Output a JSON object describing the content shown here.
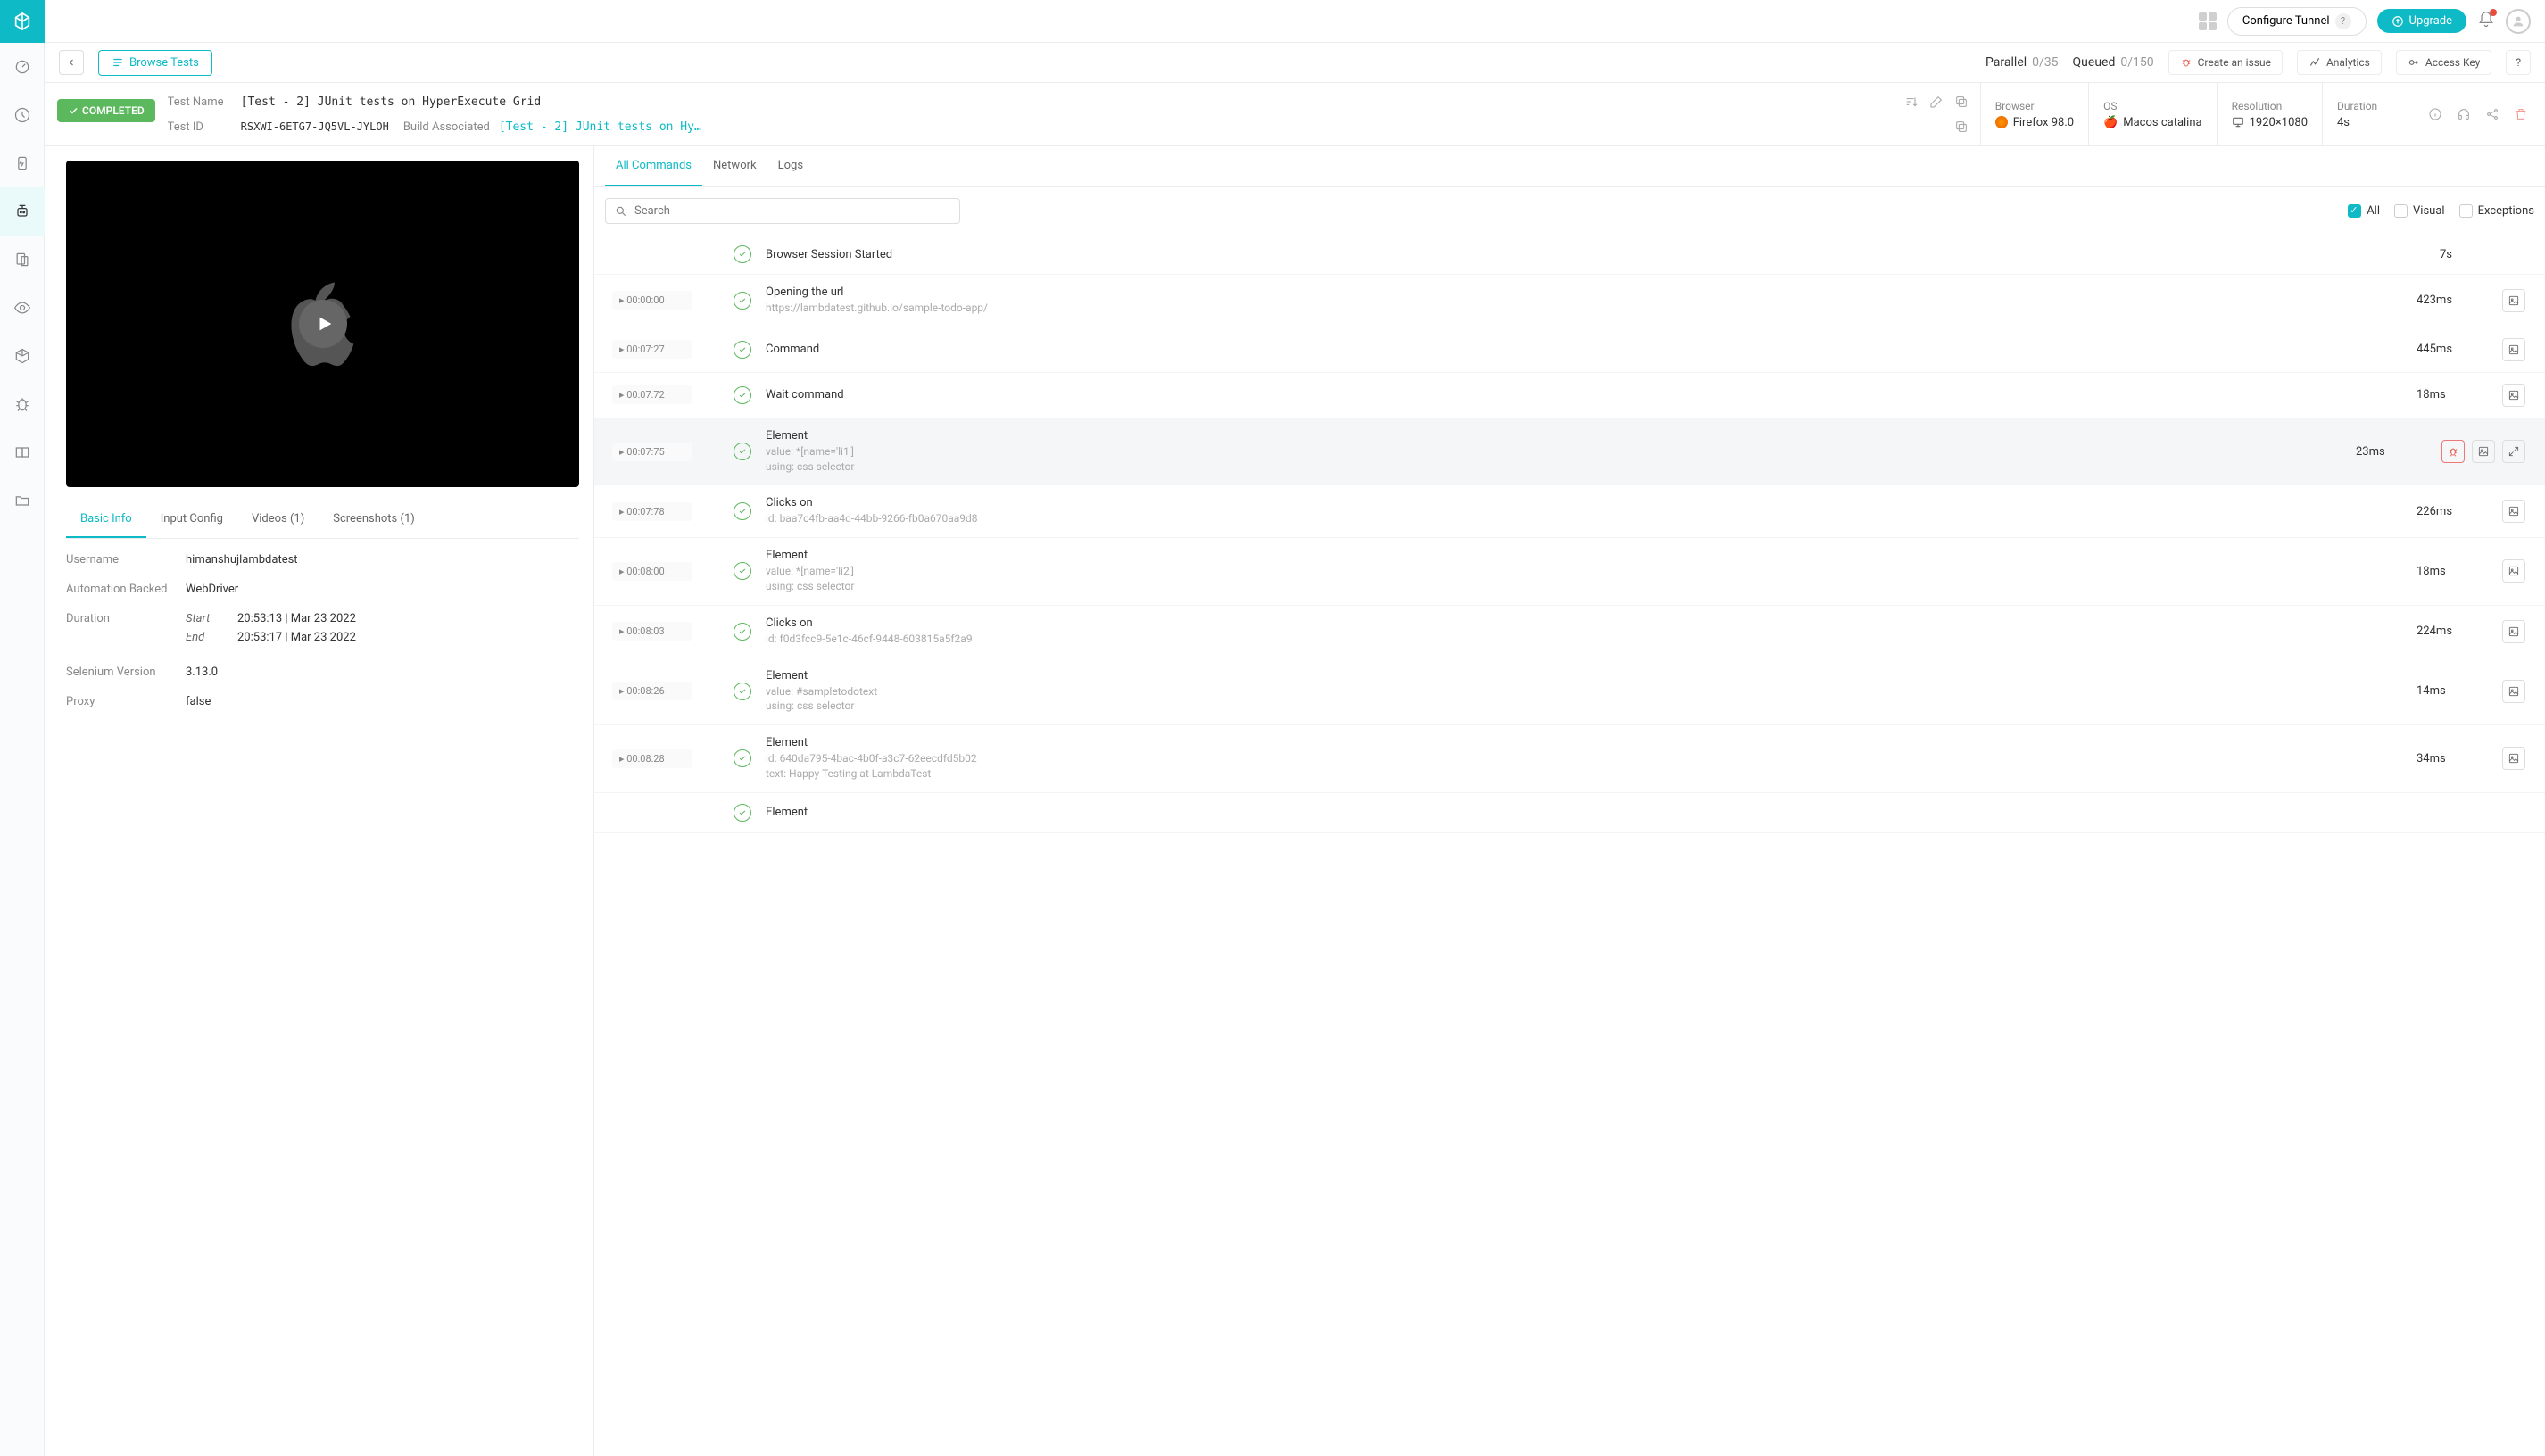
{
  "header": {
    "configure_tunnel": "Configure Tunnel",
    "upgrade": "Upgrade"
  },
  "subheader": {
    "browse_tests": "Browse Tests",
    "parallel_label": "Parallel",
    "parallel_value": "0/35",
    "queued_label": "Queued",
    "queued_value": "0/150",
    "create_issue": "Create an issue",
    "analytics": "Analytics",
    "access_key": "Access Key"
  },
  "meta": {
    "status": "COMPLETED",
    "test_name_label": "Test Name",
    "test_name": "[Test - 2] JUnit tests on HyperExecute Grid",
    "test_id_label": "Test ID",
    "test_id": "RSXWI-6ETG7-JQ5VL-JYLOH",
    "build_label": "Build Associated",
    "build_link": "[Test - 2] JUnit tests on Hy…",
    "browser_label": "Browser",
    "browser": "Firefox 98.0",
    "os_label": "OS",
    "os": "Macos catalina",
    "resolution_label": "Resolution",
    "resolution": "1920×1080",
    "duration_label": "Duration",
    "duration": "4s"
  },
  "left_tabs": [
    "Basic Info",
    "Input Config",
    "Videos (1)",
    "Screenshots (1)"
  ],
  "basic_info": {
    "username_k": "Username",
    "username_v": "himanshujlambdatest",
    "backed_k": "Automation Backed",
    "backed_v": "WebDriver",
    "duration_k": "Duration",
    "start_k": "Start",
    "start_v": "20:53:13 | Mar 23 2022",
    "end_k": "End",
    "end_v": "20:53:17 | Mar 23 2022",
    "selenium_k": "Selenium Version",
    "selenium_v": "3.13.0",
    "proxy_k": "Proxy",
    "proxy_v": "false"
  },
  "cmd_tabs": [
    "All Commands",
    "Network",
    "Logs"
  ],
  "search_placeholder": "Search",
  "filters": {
    "all": "All",
    "visual": "Visual",
    "exceptions": "Exceptions"
  },
  "commands": [
    {
      "ts": "",
      "title": "Browser Session Started",
      "sub": "",
      "dur": "7s",
      "screenshot": false,
      "selected": false
    },
    {
      "ts": "00:00:00",
      "title": "Opening the url",
      "sub": "https://lambdatest.github.io/sample-todo-app/",
      "dur": "423ms",
      "screenshot": true,
      "selected": false
    },
    {
      "ts": "00:07:27",
      "title": "Command",
      "sub": "",
      "dur": "445ms",
      "screenshot": true,
      "selected": false
    },
    {
      "ts": "00:07:72",
      "title": "Wait command",
      "sub": "",
      "dur": "18ms",
      "screenshot": true,
      "selected": false
    },
    {
      "ts": "00:07:75",
      "title": "Element",
      "sub": "value: *[name='li1']\nusing: css selector",
      "dur": "23ms",
      "screenshot": true,
      "selected": true
    },
    {
      "ts": "00:07:78",
      "title": "Clicks on",
      "sub": "id: baa7c4fb-aa4d-44bb-9266-fb0a670aa9d8",
      "dur": "226ms",
      "screenshot": true,
      "selected": false
    },
    {
      "ts": "00:08:00",
      "title": "Element",
      "sub": "value: *[name='li2']\nusing: css selector",
      "dur": "18ms",
      "screenshot": true,
      "selected": false
    },
    {
      "ts": "00:08:03",
      "title": "Clicks on",
      "sub": "id: f0d3fcc9-5e1c-46cf-9448-603815a5f2a9",
      "dur": "224ms",
      "screenshot": true,
      "selected": false
    },
    {
      "ts": "00:08:26",
      "title": "Element",
      "sub": "value: #sampletodotext\nusing: css selector",
      "dur": "14ms",
      "screenshot": true,
      "selected": false
    },
    {
      "ts": "00:08:28",
      "title": "Element",
      "sub": "id: 640da795-4bac-4b0f-a3c7-62eecdfd5b02\ntext: Happy Testing at LambdaTest",
      "dur": "34ms",
      "screenshot": true,
      "selected": false
    },
    {
      "ts": "",
      "title": "Element",
      "sub": "",
      "dur": "",
      "screenshot": false,
      "selected": false
    }
  ]
}
